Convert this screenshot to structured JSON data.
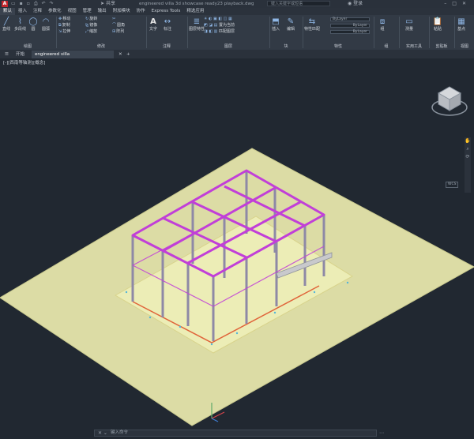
{
  "app": {
    "doc_title": "engineered villa 3d showcase ready23 playback.dwg",
    "share_label": "共享",
    "search_placeholder": "键入关键字或短语",
    "login_label": "登录",
    "logo_letter": "A"
  },
  "menu": [
    "默认",
    "插入",
    "注释",
    "参数化",
    "视图",
    "管理",
    "输出",
    "附加模块",
    "协作",
    "Express Tools",
    "精选应用"
  ],
  "ribbon": {
    "draw": {
      "line": "直线",
      "polyline": "多段线",
      "circle": "圆",
      "arc": "圆弧",
      "label": "绘图"
    },
    "modify": {
      "move": "移动",
      "rotate": "旋转",
      "copy": "复制",
      "mirror": "镜像",
      "stretch": "拉伸",
      "scale": "缩放",
      "fillet": "圆角",
      "array": "阵列",
      "label": "修改"
    },
    "annotation": {
      "text": "文字",
      "dimension": "标注",
      "label": "注释"
    },
    "layers": {
      "layer_props": "图层特性",
      "make_current": "置为当前",
      "match": "匹配图层",
      "label": "图层"
    },
    "block": {
      "insert": "插入",
      "edit": "编辑",
      "label": "块"
    },
    "properties": {
      "match_props": "特性匹配",
      "bylayer1": "ByLayer",
      "bylayer2": "ByLayer",
      "bylayer3": "ByLayer",
      "label": "特性"
    },
    "groups": {
      "group": "组",
      "label": "组"
    },
    "utilities": {
      "measure": "测量",
      "label": "实用工具"
    },
    "clipboard": {
      "paste": "粘贴",
      "label": "剪贴板"
    },
    "view": {
      "base": "基点",
      "label": "视图"
    }
  },
  "tabs": {
    "start": "开始",
    "active_doc": "engineered villa _..e_ready23_playback"
  },
  "viewport": {
    "label": "[-][西南等轴测][概念]",
    "viewcube_label": "WCS"
  },
  "command": {
    "placeholder": "键入命令"
  },
  "colors": {
    "frame_magenta": "#c13fd8",
    "ground": "#dcdca5",
    "slab": "#ecedb6",
    "background": "#212831"
  }
}
